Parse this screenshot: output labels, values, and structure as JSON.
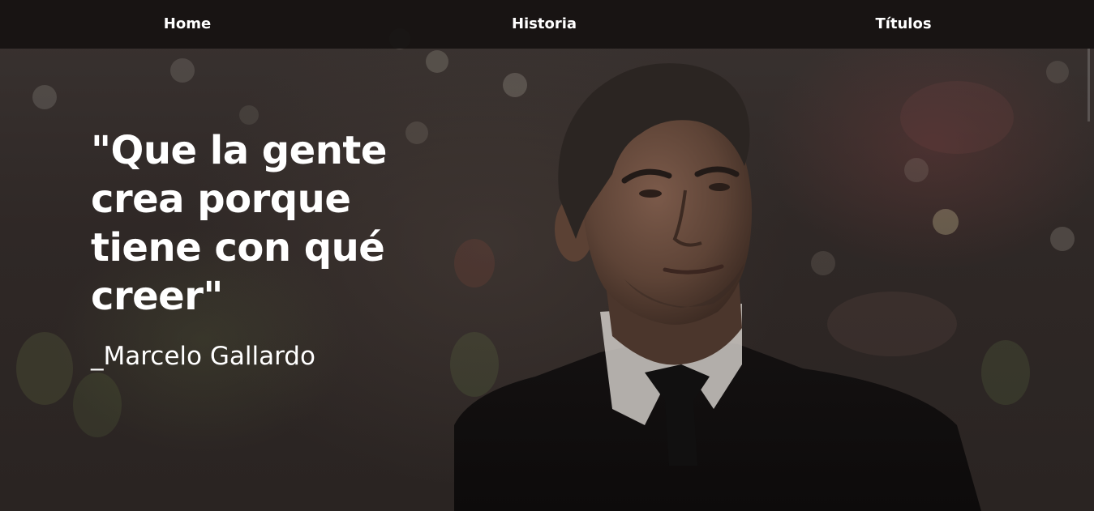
{
  "nav": {
    "items": [
      {
        "label": "Home"
      },
      {
        "label": "Historia"
      },
      {
        "label": "Títulos"
      }
    ]
  },
  "hero": {
    "quote": "\"Que la gente crea porque tiene con qué creer\"",
    "author": "_Marcelo Gallardo"
  },
  "colors": {
    "navbar_background": "#161211",
    "text": "#ffffff",
    "overlay": "#2a2321"
  }
}
